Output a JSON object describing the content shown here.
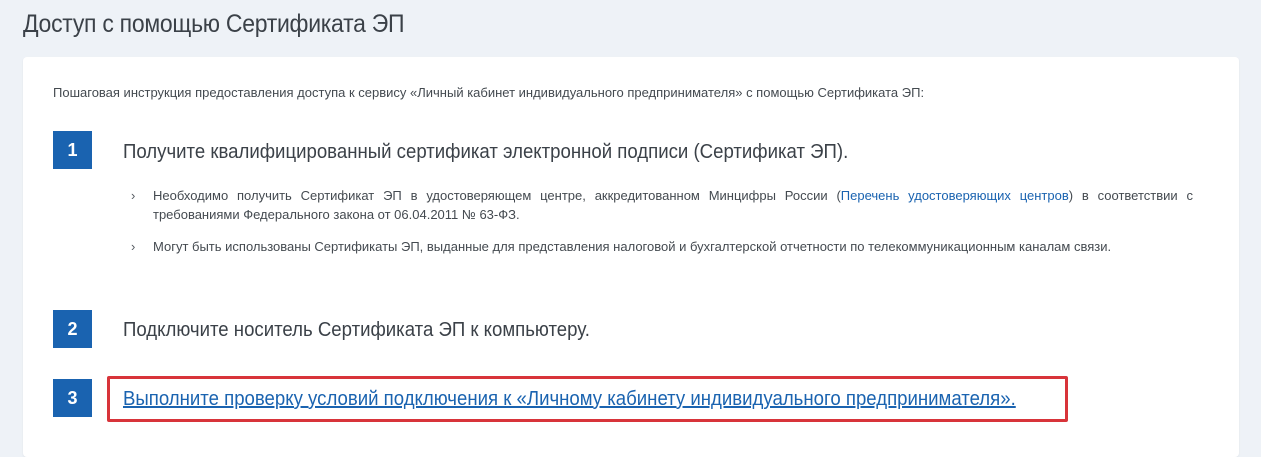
{
  "page": {
    "title": "Доступ с помощью Сертификата ЭП"
  },
  "card": {
    "intro": "Пошаговая инструкция предоставления доступа к сервису «Личный кабинет индивидуального предпринимателя» с помощью Сертификата ЭП:"
  },
  "steps": [
    {
      "number": "1",
      "title": "Получите квалифицированный сертификат электронной подписи (Сертификат ЭП).",
      "bullets": [
        {
          "before_link": "Необходимо получить Сертификат ЭП в удостоверяющем центре, аккредитованном Минцифры России (",
          "link_text": "Перечень удостоверяющих центров",
          "after_link": ") в соответствии с требованиями Федерального закона от 06.04.2011 № 63-ФЗ."
        },
        {
          "text": "Могут быть использованы Сертификаты ЭП, выданные для представления налоговой и бухгалтерской отчетности по телекоммуникационным каналам связи."
        }
      ]
    },
    {
      "number": "2",
      "title": "Подключите носитель Сертификата ЭП к компьютеру."
    },
    {
      "number": "3",
      "title": "Выполните проверку условий подключения к «Личному кабинету индивидуального предпринимателя»."
    }
  ],
  "icons": {
    "bullet": "chevron-right-icon",
    "bullet_glyph": "›"
  },
  "colors": {
    "accent": "#1a63b0",
    "highlight": "#d8343a",
    "background": "#eef2f7"
  }
}
